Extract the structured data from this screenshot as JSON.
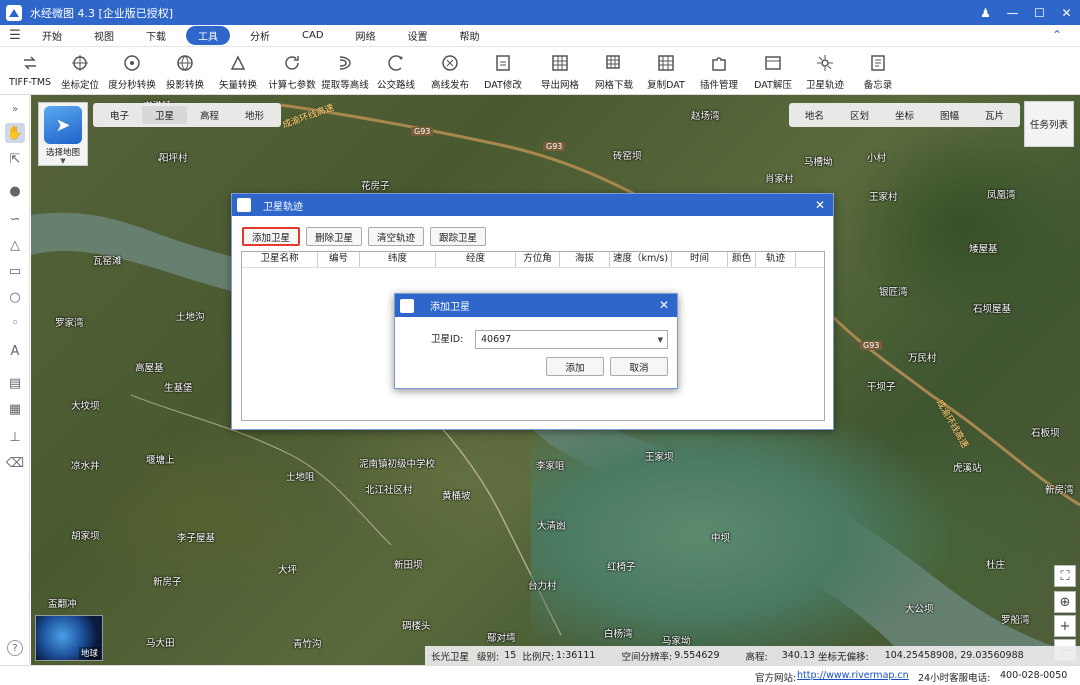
{
  "app": {
    "title": "水经微图 4.3 [企业版已授权]"
  },
  "menu": {
    "items": [
      "开始",
      "视图",
      "下载",
      "工具",
      "分析",
      "CAD",
      "网络",
      "设置",
      "帮助"
    ],
    "active_index": 3
  },
  "toolbar": {
    "tools": [
      "TIFF-TMS",
      "坐标定位",
      "度分秒转换",
      "投影转换",
      "矢量转换",
      "计算七参数",
      "提取等高线",
      "公交路线",
      "高线发布",
      "DAT修改",
      "导出网格",
      "网格下载",
      "复制DAT",
      "插件管理",
      "DAT解压",
      "卫星轨迹",
      "备忘录"
    ]
  },
  "map": {
    "select_map_label": "选择地图",
    "tabs": [
      "电子",
      "卫星",
      "高程",
      "地形"
    ],
    "active_tab_index": 1,
    "right_tabs": [
      "地名",
      "区划",
      "坐标",
      "图幅",
      "瓦片"
    ],
    "task_list": "任务列表",
    "globe_label": "地球",
    "road_tags": [
      "G93",
      "G93",
      "G93"
    ],
    "highway_labels": [
      "成渝环线高速",
      "成渝环线高速"
    ],
    "places": [
      "书港镇",
      "阳坪村",
      "花房子",
      "赵场湾",
      "砖窑坝",
      "马槽坳",
      "小村",
      "肖家村",
      "王家村",
      "凤凰湾",
      "瓦窑滩",
      "土地沟",
      "罗家湾",
      "高屋基",
      "生基堡",
      "大坟坝",
      "凉水井",
      "堰塘上",
      "土地咀",
      "泥南镇初级中学校",
      "北江社区村",
      "黄桶坡",
      "李家咀",
      "大清凼",
      "王家坝",
      "胡家坝",
      "李子屋基",
      "大坪",
      "新田坝",
      "新房子",
      "盃翻冲",
      "马大田",
      "青竹沟",
      "碉楼头",
      "鄢对塆",
      "白杨湾",
      "马家坳",
      "台力村",
      "红椅子",
      "中坝",
      "银匠湾",
      "万民村",
      "干坝子",
      "石坝屋基",
      "矮屋基",
      "石板坝",
      "虎溪站",
      "新房湾",
      "大公坝",
      "罗船湾",
      "杜庄"
    ]
  },
  "status": {
    "sat_name": "长光卫星",
    "level_label": "级别:",
    "level": "15",
    "scale_label": "比例尺:",
    "scale": "1:36111",
    "resolution_label": "空间分辨率:",
    "resolution": "9.554629",
    "elevation_label": "高程:",
    "elevation": "340.13",
    "offset_label": "坐标无偏移:",
    "coords": "104.25458908, 29.03560988"
  },
  "footer": {
    "site_label": "官方网站:",
    "site_url": "http://www.rivermap.cn",
    "phone_label": "24小时客服电话:",
    "phone": "400-028-0050"
  },
  "dialog": {
    "title": "卫星轨迹",
    "buttons": [
      "添加卫星",
      "删除卫星",
      "清空轨迹",
      "跟踪卫星"
    ],
    "columns": [
      "卫星名称",
      "编号",
      "纬度",
      "经度",
      "方位角",
      "海拔",
      "速度（km/s)",
      "时间",
      "颜色",
      "轨迹"
    ]
  },
  "subdialog": {
    "title": "添加卫星",
    "label": "卫星ID:",
    "value": "40697",
    "ok": "添加",
    "cancel": "取消"
  }
}
